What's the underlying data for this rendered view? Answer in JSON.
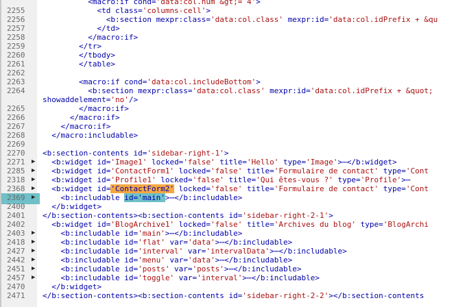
{
  "lines": [
    {
      "num": "2255",
      "arrow": "",
      "segs": [
        [
          "t",
          "            <td class="
        ],
        [
          "s",
          "'columns-cell'"
        ],
        [
          "t",
          ">"
        ]
      ]
    },
    {
      "num": "2256",
      "arrow": "",
      "segs": [
        [
          "t",
          "              <b:section mexpr:class="
        ],
        [
          "s",
          "'data:col.class'"
        ],
        [
          "t",
          " mexpr:id="
        ],
        [
          "s",
          "'data:col.idPrefix + &qu"
        ]
      ]
    },
    {
      "num": "2257",
      "arrow": "",
      "segs": [
        [
          "t",
          "            </td>"
        ]
      ]
    },
    {
      "num": "2258",
      "arrow": "",
      "segs": [
        [
          "t",
          "          </macro:if>"
        ]
      ]
    },
    {
      "num": "2259",
      "arrow": "",
      "segs": [
        [
          "t",
          "        </tr>"
        ]
      ]
    },
    {
      "num": "2260",
      "arrow": "",
      "segs": [
        [
          "t",
          "        </tbody>"
        ]
      ]
    },
    {
      "num": "2261",
      "arrow": "",
      "segs": [
        [
          "t",
          "        </table>"
        ]
      ]
    },
    {
      "num": "2262",
      "arrow": "",
      "segs": [
        [
          "t",
          ""
        ]
      ]
    },
    {
      "num": "2263",
      "arrow": "",
      "segs": [
        [
          "t",
          "        <macro:if cond="
        ],
        [
          "s",
          "'data:col.includeBottom'"
        ],
        [
          "t",
          ">"
        ]
      ]
    },
    {
      "num": "2264",
      "arrow": "",
      "segs": [
        [
          "t",
          "          <b:section mexpr:class="
        ],
        [
          "s",
          "'data:col.class'"
        ],
        [
          "t",
          " mexpr:id="
        ],
        [
          "s",
          "'data:col.idPrefix + &quot;"
        ]
      ]
    },
    {
      "num": "",
      "arrow": "",
      "segs": [
        [
          "t",
          "showaddelement="
        ],
        [
          "s",
          "'no'"
        ],
        [
          "t",
          "/>"
        ]
      ]
    },
    {
      "num": "2265",
      "arrow": "",
      "segs": [
        [
          "t",
          "        </macro:if>"
        ]
      ]
    },
    {
      "num": "2266",
      "arrow": "",
      "segs": [
        [
          "t",
          "      </macro:if>"
        ]
      ]
    },
    {
      "num": "2267",
      "arrow": "",
      "segs": [
        [
          "t",
          "    </macro:if>"
        ]
      ]
    },
    {
      "num": "2268",
      "arrow": "",
      "segs": [
        [
          "t",
          "  </macro:includable>"
        ]
      ]
    },
    {
      "num": "2269",
      "arrow": "",
      "segs": [
        [
          "t",
          ""
        ]
      ]
    },
    {
      "num": "2270",
      "arrow": "",
      "segs": [
        [
          "t",
          "<b:section-contents id="
        ],
        [
          "s",
          "'sidebar-right-1'"
        ],
        [
          "t",
          ">"
        ]
      ]
    },
    {
      "num": "2271",
      "arrow": "▶",
      "segs": [
        [
          "t",
          "  <b:widget id="
        ],
        [
          "s",
          "'Image1'"
        ],
        [
          "t",
          " locked="
        ],
        [
          "s",
          "'false'"
        ],
        [
          "t",
          " title="
        ],
        [
          "s",
          "'Hello'"
        ],
        [
          "t",
          " type="
        ],
        [
          "s",
          "'Image'"
        ],
        [
          "t",
          ">⋯</b:widget>"
        ]
      ]
    },
    {
      "num": "2285",
      "arrow": "▶",
      "segs": [
        [
          "t",
          "  <b:widget id="
        ],
        [
          "s",
          "'ContactForm1'"
        ],
        [
          "t",
          " locked="
        ],
        [
          "s",
          "'false'"
        ],
        [
          "t",
          " title="
        ],
        [
          "s",
          "'Formulaire de contact'"
        ],
        [
          "t",
          " type="
        ],
        [
          "s",
          "'Cont"
        ]
      ]
    },
    {
      "num": "2318",
      "arrow": "▶",
      "segs": [
        [
          "t",
          "  <b:widget id="
        ],
        [
          "s",
          "'Profile1'"
        ],
        [
          "t",
          " locked="
        ],
        [
          "s",
          "'false'"
        ],
        [
          "t",
          " title="
        ],
        [
          "s",
          "'Qui êtes-vous ?'"
        ],
        [
          "t",
          " type="
        ],
        [
          "s",
          "'Profile'"
        ],
        [
          "t",
          ">⋯"
        ]
      ]
    },
    {
      "num": "2368",
      "arrow": "▶",
      "segs": [
        [
          "t",
          "  <b:widget id="
        ],
        [
          "o",
          "'ContactForm2'"
        ],
        [
          "t",
          " locked="
        ],
        [
          "s",
          "'false'"
        ],
        [
          "t",
          " title="
        ],
        [
          "s",
          "'Formulaire de contact'"
        ],
        [
          "t",
          " type="
        ],
        [
          "s",
          "'Cont"
        ]
      ]
    },
    {
      "num": "2369",
      "arrow": "▶",
      "hl": true,
      "segs": [
        [
          "t",
          "    <b:includable "
        ],
        [
          "c",
          "id='main'"
        ],
        [
          "t",
          ">⋯</b:includable>"
        ]
      ]
    },
    {
      "num": "2400",
      "arrow": "",
      "segs": [
        [
          "t",
          "  </b:widget>"
        ]
      ]
    },
    {
      "num": "2401",
      "arrow": "",
      "segs": [
        [
          "t",
          "</b:section-contents><b:section-contents id="
        ],
        [
          "s",
          "'sidebar-right-2-1'"
        ],
        [
          "t",
          ">"
        ]
      ]
    },
    {
      "num": "2402",
      "arrow": "",
      "segs": [
        [
          "t",
          "  <b:widget id="
        ],
        [
          "s",
          "'BlogArchive1'"
        ],
        [
          "t",
          " locked="
        ],
        [
          "s",
          "'false'"
        ],
        [
          "t",
          " title="
        ],
        [
          "s",
          "'Archives du blog'"
        ],
        [
          "t",
          " type="
        ],
        [
          "s",
          "'BlogArchi"
        ]
      ]
    },
    {
      "num": "2403",
      "arrow": "▶",
      "segs": [
        [
          "t",
          "    <b:includable id="
        ],
        [
          "s",
          "'main'"
        ],
        [
          "t",
          ">⋯</b:includable>"
        ]
      ]
    },
    {
      "num": "2418",
      "arrow": "▶",
      "segs": [
        [
          "t",
          "    <b:includable id="
        ],
        [
          "s",
          "'flat'"
        ],
        [
          "t",
          " var="
        ],
        [
          "s",
          "'data'"
        ],
        [
          "t",
          ">⋯</b:includable>"
        ]
      ]
    },
    {
      "num": "2427",
      "arrow": "▶",
      "segs": [
        [
          "t",
          "    <b:includable id="
        ],
        [
          "s",
          "'interval'"
        ],
        [
          "t",
          " var="
        ],
        [
          "s",
          "'intervalData'"
        ],
        [
          "t",
          ">⋯</b:includable>"
        ]
      ]
    },
    {
      "num": "2442",
      "arrow": "▶",
      "segs": [
        [
          "t",
          "    <b:includable id="
        ],
        [
          "s",
          "'menu'"
        ],
        [
          "t",
          " var="
        ],
        [
          "s",
          "'data'"
        ],
        [
          "t",
          ">⋯</b:includable>"
        ]
      ]
    },
    {
      "num": "2451",
      "arrow": "▶",
      "segs": [
        [
          "t",
          "    <b:includable id="
        ],
        [
          "s",
          "'posts'"
        ],
        [
          "t",
          " var="
        ],
        [
          "s",
          "'posts'"
        ],
        [
          "t",
          ">⋯</b:includable>"
        ]
      ]
    },
    {
      "num": "2457",
      "arrow": "▶",
      "segs": [
        [
          "t",
          "    <b:includable id="
        ],
        [
          "s",
          "'toggle'"
        ],
        [
          "t",
          " var="
        ],
        [
          "s",
          "'interval'"
        ],
        [
          "t",
          ">⋯</b:includable>"
        ]
      ]
    },
    {
      "num": "2470",
      "arrow": "",
      "segs": [
        [
          "t",
          "  </b:widget>"
        ]
      ]
    },
    {
      "num": "2471",
      "arrow": "",
      "segs": [
        [
          "t",
          "</b:section-contents><b:section-contents id="
        ],
        [
          "s",
          "'sidebar-right-2-2'"
        ],
        [
          "t",
          "></b:section-contents"
        ]
      ]
    }
  ],
  "top_partial": {
    "segs": [
      [
        "t",
        "          <macro:if cond="
      ],
      [
        "s",
        "'data:col.num &gt;= 4'"
      ],
      [
        "t",
        ">"
      ]
    ]
  }
}
